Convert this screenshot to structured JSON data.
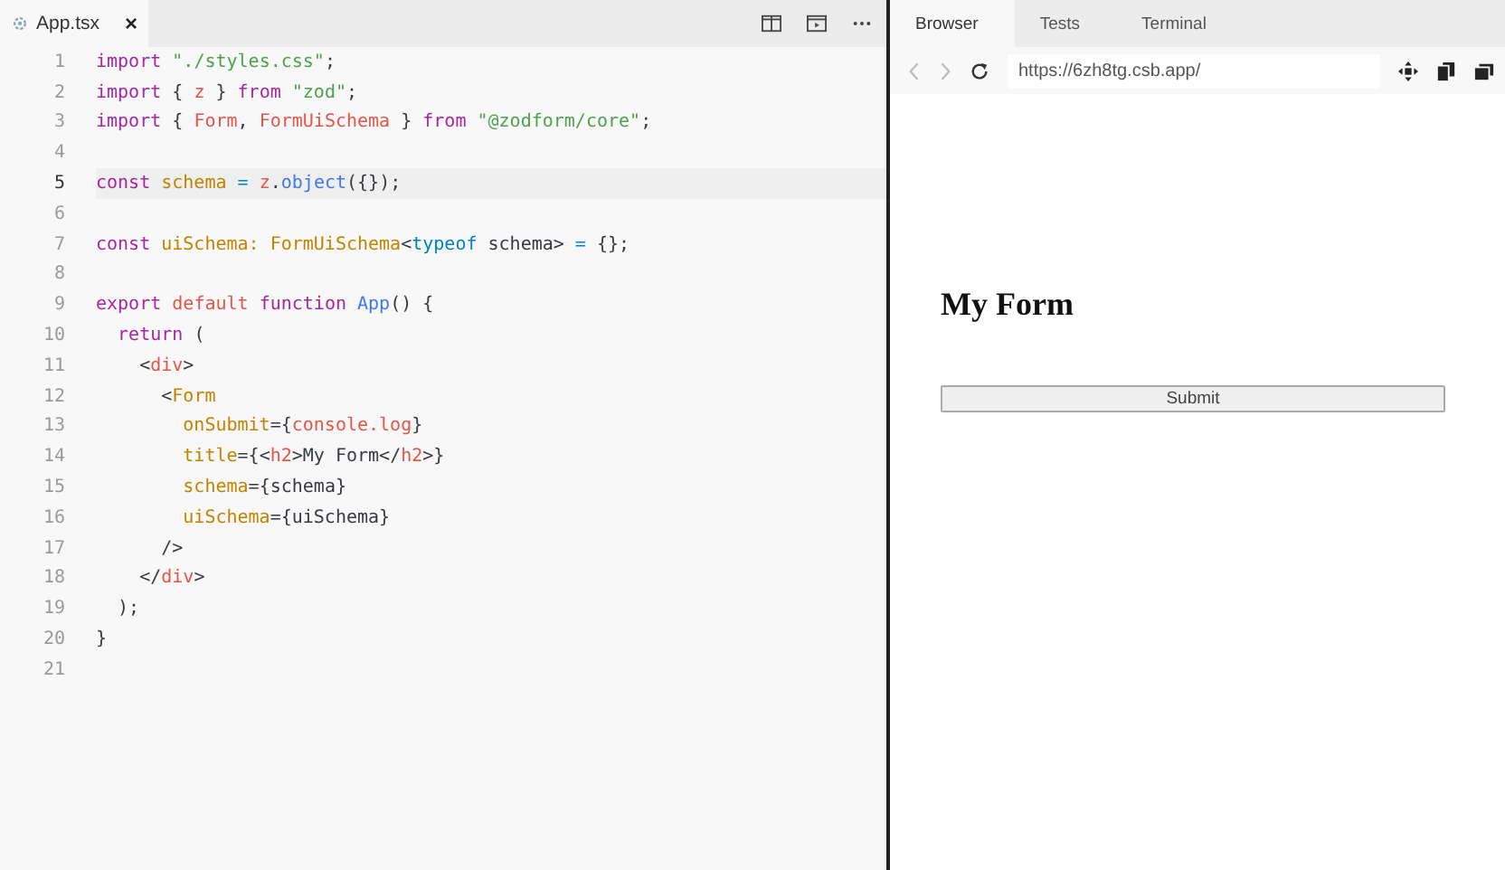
{
  "editor": {
    "tab": {
      "label": "App.tsx",
      "close": "×"
    },
    "lines": [
      {
        "number": "1",
        "current": false,
        "tokens": [
          {
            "kind": "kw",
            "text": "import "
          },
          {
            "kind": "str",
            "text": "\"./styles.css\""
          },
          {
            "kind": "plain",
            "text": ";"
          }
        ]
      },
      {
        "number": "2",
        "current": false,
        "tokens": [
          {
            "kind": "kw",
            "text": "import"
          },
          {
            "kind": "plain",
            "text": " { "
          },
          {
            "kind": "var",
            "text": "z"
          },
          {
            "kind": "plain",
            "text": " } "
          },
          {
            "kind": "kw",
            "text": "from "
          },
          {
            "kind": "str",
            "text": "\"zod\""
          },
          {
            "kind": "plain",
            "text": ";"
          }
        ]
      },
      {
        "number": "3",
        "current": false,
        "tokens": [
          {
            "kind": "kw",
            "text": "import"
          },
          {
            "kind": "plain",
            "text": " { "
          },
          {
            "kind": "var",
            "text": "Form"
          },
          {
            "kind": "plain",
            "text": ", "
          },
          {
            "kind": "var",
            "text": "FormUiSchema"
          },
          {
            "kind": "plain",
            "text": " } "
          },
          {
            "kind": "kw",
            "text": "from "
          },
          {
            "kind": "str",
            "text": "\"@zodform/core\""
          },
          {
            "kind": "plain",
            "text": ";"
          }
        ]
      },
      {
        "number": "4",
        "current": false
      },
      {
        "number": "5",
        "current": true,
        "tokens": [
          {
            "kind": "kw",
            "text": "const "
          },
          {
            "kind": "type",
            "text": "schema "
          },
          {
            "kind": "op",
            "text": "= "
          },
          {
            "kind": "var",
            "text": "z"
          },
          {
            "kind": "plain",
            "text": "."
          },
          {
            "kind": "fn",
            "text": "object"
          },
          {
            "kind": "plain",
            "text": "({});"
          }
        ]
      },
      {
        "number": "6",
        "current": false
      },
      {
        "number": "7",
        "current": false,
        "tokens": [
          {
            "kind": "kw",
            "text": "const "
          },
          {
            "kind": "type",
            "text": "uiSchema: FormUiSchema"
          },
          {
            "kind": "plain",
            "text": "<"
          },
          {
            "kind": "op",
            "text": "typeof"
          },
          {
            "kind": "plain",
            "text": " schema> "
          },
          {
            "kind": "op",
            "text": "="
          },
          {
            "kind": "plain",
            "text": " {};"
          }
        ]
      },
      {
        "number": "8",
        "current": false
      },
      {
        "number": "9",
        "current": false,
        "tokens": [
          {
            "kind": "kw",
            "text": "export "
          },
          {
            "kind": "var",
            "text": "default "
          },
          {
            "kind": "kw",
            "text": "function "
          },
          {
            "kind": "fn",
            "text": "App"
          },
          {
            "kind": "plain",
            "text": "() {"
          }
        ]
      },
      {
        "number": "10",
        "current": false,
        "tokens": [
          {
            "kind": "kw",
            "text": "  return"
          },
          {
            "kind": "plain",
            "text": " ("
          }
        ]
      },
      {
        "number": "11",
        "current": false,
        "tokens": [
          {
            "kind": "plain",
            "text": "    <"
          },
          {
            "kind": "var",
            "text": "div"
          },
          {
            "kind": "plain",
            "text": ">"
          }
        ]
      },
      {
        "number": "12",
        "current": false,
        "tokens": [
          {
            "kind": "plain",
            "text": "      <"
          },
          {
            "kind": "type",
            "text": "Form"
          }
        ]
      },
      {
        "number": "13",
        "current": false,
        "tokens": [
          {
            "kind": "type",
            "text": "        onSubmit"
          },
          {
            "kind": "plain",
            "text": "={"
          },
          {
            "kind": "var",
            "text": "console.log"
          },
          {
            "kind": "plain",
            "text": "}"
          }
        ]
      },
      {
        "number": "14",
        "current": false,
        "tokens": [
          {
            "kind": "type",
            "text": "        title"
          },
          {
            "kind": "plain",
            "text": "={<"
          },
          {
            "kind": "var",
            "text": "h2"
          },
          {
            "kind": "plain",
            "text": ">My Form</"
          },
          {
            "kind": "var",
            "text": "h2"
          },
          {
            "kind": "plain",
            "text": ">}"
          }
        ]
      },
      {
        "number": "15",
        "current": false,
        "tokens": [
          {
            "kind": "type",
            "text": "        schema"
          },
          {
            "kind": "plain",
            "text": "={schema}"
          }
        ]
      },
      {
        "number": "16",
        "current": false,
        "tokens": [
          {
            "kind": "type",
            "text": "        uiSchema"
          },
          {
            "kind": "plain",
            "text": "={uiSchema}"
          }
        ]
      },
      {
        "number": "17",
        "current": false,
        "tokens": [
          {
            "kind": "plain",
            "text": "      />"
          }
        ]
      },
      {
        "number": "18",
        "current": false,
        "tokens": [
          {
            "kind": "plain",
            "text": "    </"
          },
          {
            "kind": "var",
            "text": "div"
          },
          {
            "kind": "plain",
            "text": ">"
          }
        ]
      },
      {
        "number": "19",
        "current": false,
        "tokens": [
          {
            "kind": "plain",
            "text": "  );"
          }
        ]
      },
      {
        "number": "20",
        "current": false,
        "tokens": [
          {
            "kind": "plain",
            "text": "}"
          }
        ]
      },
      {
        "number": "21",
        "current": false
      }
    ]
  },
  "preview": {
    "tabs": [
      {
        "label": "Browser",
        "selected": true
      },
      {
        "label": "Tests",
        "selected": false
      },
      {
        "label": "Terminal",
        "selected": false
      }
    ],
    "url": "https://6zh8tg.csb.app/",
    "page": {
      "title": "My Form",
      "submit": "Submit"
    }
  }
}
